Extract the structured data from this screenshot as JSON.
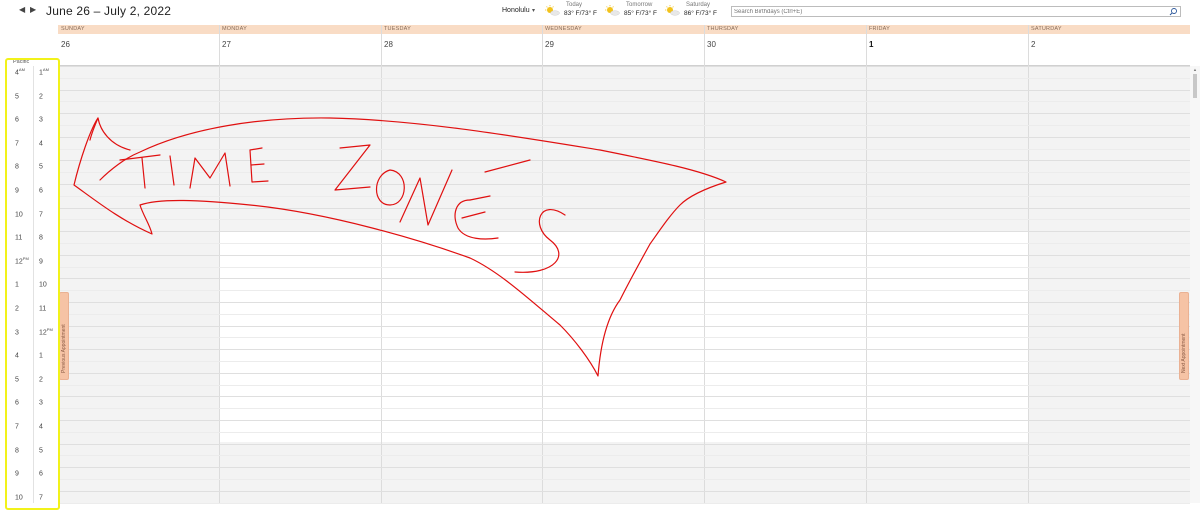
{
  "header": {
    "date_range": "June 26 – July 2, 2022",
    "location": "Honolulu",
    "weather": [
      {
        "day": "Today",
        "temp": "83° F/73° F",
        "icon": "sun-cloud-icon"
      },
      {
        "day": "Tomorrow",
        "temp": "85° F/73° F",
        "icon": "sun-cloud-icon"
      },
      {
        "day": "Saturday",
        "temp": "86° F/73° F",
        "icon": "sun-cloud-icon"
      }
    ],
    "search_placeholder": "Search Birthdays (Ctrl+E)"
  },
  "days": [
    {
      "name": "SUNDAY",
      "date": "26"
    },
    {
      "name": "MONDAY",
      "date": "27"
    },
    {
      "name": "TUESDAY",
      "date": "28"
    },
    {
      "name": "WEDNESDAY",
      "date": "29"
    },
    {
      "name": "THURSDAY",
      "date": "30"
    },
    {
      "name": "FRIDAY",
      "date": "1"
    },
    {
      "name": "SATURDAY",
      "date": "2"
    }
  ],
  "timezone_label": "Pacific",
  "hours": [
    {
      "tz1": "4",
      "tz1_suffix": "AM",
      "tz2": "1",
      "tz2_suffix": "AM"
    },
    {
      "tz1": "5",
      "tz1_suffix": "",
      "tz2": "2",
      "tz2_suffix": ""
    },
    {
      "tz1": "6",
      "tz1_suffix": "",
      "tz2": "3",
      "tz2_suffix": ""
    },
    {
      "tz1": "7",
      "tz1_suffix": "",
      "tz2": "4",
      "tz2_suffix": ""
    },
    {
      "tz1": "8",
      "tz1_suffix": "",
      "tz2": "5",
      "tz2_suffix": ""
    },
    {
      "tz1": "9",
      "tz1_suffix": "",
      "tz2": "6",
      "tz2_suffix": ""
    },
    {
      "tz1": "10",
      "tz1_suffix": "",
      "tz2": "7",
      "tz2_suffix": ""
    },
    {
      "tz1": "11",
      "tz1_suffix": "",
      "tz2": "8",
      "tz2_suffix": ""
    },
    {
      "tz1": "12",
      "tz1_suffix": "PM",
      "tz2": "9",
      "tz2_suffix": ""
    },
    {
      "tz1": "1",
      "tz1_suffix": "",
      "tz2": "10",
      "tz2_suffix": ""
    },
    {
      "tz1": "2",
      "tz1_suffix": "",
      "tz2": "11",
      "tz2_suffix": ""
    },
    {
      "tz1": "3",
      "tz1_suffix": "",
      "tz2": "12",
      "tz2_suffix": "PM"
    },
    {
      "tz1": "4",
      "tz1_suffix": "",
      "tz2": "1",
      "tz2_suffix": ""
    },
    {
      "tz1": "5",
      "tz1_suffix": "",
      "tz2": "2",
      "tz2_suffix": ""
    },
    {
      "tz1": "6",
      "tz1_suffix": "",
      "tz2": "3",
      "tz2_suffix": ""
    },
    {
      "tz1": "7",
      "tz1_suffix": "",
      "tz2": "4",
      "tz2_suffix": ""
    },
    {
      "tz1": "8",
      "tz1_suffix": "",
      "tz2": "5",
      "tz2_suffix": ""
    },
    {
      "tz1": "9",
      "tz1_suffix": "",
      "tz2": "6",
      "tz2_suffix": ""
    },
    {
      "tz1": "10",
      "tz1_suffix": "",
      "tz2": "7",
      "tz2_suffix": ""
    }
  ],
  "side_tabs": {
    "previous": "Previous Appointment",
    "next": "Next Appointment"
  },
  "annotation": {
    "text": "TIME ZONES",
    "arrow_color": "#e01010",
    "highlight_color": "#f2f21a"
  },
  "colors": {
    "day_header_bg": "#f9dcc5",
    "side_tab_bg": "#f6c3a5",
    "off_hours_bg": "#f3f3f3"
  }
}
